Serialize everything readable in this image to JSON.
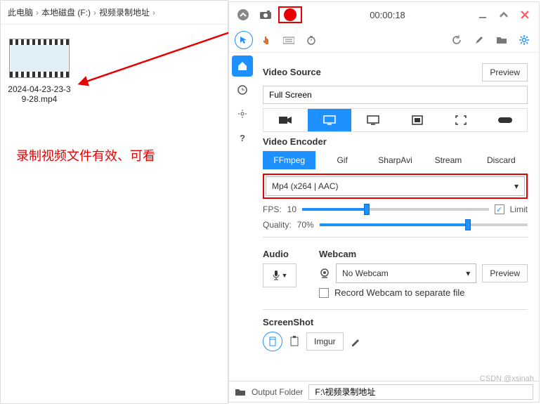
{
  "breadcrumb": {
    "a": "此电脑",
    "b": "本地磁盘 (F:)",
    "c": "视频录制地址"
  },
  "file": {
    "name": "2024-04-23-23-39-28.mp4"
  },
  "annotation": "录制视频文件有效、可看",
  "titlebar": {
    "time": "00:00:18"
  },
  "videoSource": {
    "title": "Video Source",
    "value": "Full Screen",
    "preview": "Preview"
  },
  "encoder": {
    "title": "Video Encoder",
    "tabs": [
      "FFmpeg",
      "Gif",
      "SharpAvi",
      "Stream",
      "Discard"
    ],
    "selected": "Mp4 (x264 | AAC)"
  },
  "fps": {
    "label": "FPS:",
    "value": "10",
    "limit": "Limit"
  },
  "quality": {
    "label": "Quality:",
    "value": "70%"
  },
  "audio": {
    "title": "Audio"
  },
  "webcam": {
    "title": "Webcam",
    "value": "No Webcam",
    "preview": "Preview",
    "separate": "Record Webcam to separate file"
  },
  "screenshot": {
    "title": "ScreenShot",
    "imgur": "Imgur"
  },
  "bottom": {
    "folder": "Output Folder",
    "path": "F:\\视频录制地址"
  },
  "watermark": "CSDN @xsinah"
}
